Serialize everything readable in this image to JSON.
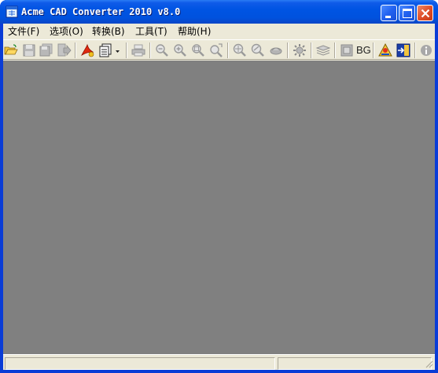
{
  "window": {
    "title": "Acme CAD Converter 2010 v8.0",
    "icon": "app-document-icon"
  },
  "caption_buttons": [
    "minimize-icon",
    "maximize-icon",
    "close-icon"
  ],
  "menu": {
    "items": [
      {
        "label": "文件(F)"
      },
      {
        "label": "选项(O)"
      },
      {
        "label": "转换(B)"
      },
      {
        "label": "工具(T)"
      },
      {
        "label": "帮助(H)"
      }
    ]
  },
  "toolbar": {
    "buttons": [
      {
        "icon": "open-folder-icon",
        "enabled": true
      },
      {
        "icon": "save-icon",
        "enabled": false
      },
      {
        "icon": "save-all-icon",
        "enabled": false
      },
      {
        "icon": "export-icon",
        "enabled": false
      },
      {
        "icon": "pdf-convert-icon",
        "enabled": true
      },
      {
        "icon": "batch-convert-dropdown-icon",
        "enabled": true
      },
      {
        "icon": "print-icon",
        "enabled": false
      },
      {
        "icon": "zoom-out-icon",
        "enabled": false
      },
      {
        "icon": "zoom-in-icon",
        "enabled": false
      },
      {
        "icon": "zoom-fit-icon",
        "enabled": false
      },
      {
        "icon": "zoom-extents-icon",
        "enabled": false
      },
      {
        "icon": "zoom-window-icon",
        "enabled": false
      },
      {
        "icon": "zoom-realtime-icon",
        "enabled": false
      },
      {
        "icon": "pan-icon",
        "enabled": false
      },
      {
        "icon": "settings-icon",
        "enabled": false
      },
      {
        "icon": "layers-icon",
        "enabled": false
      },
      {
        "icon": "black-white-icon",
        "enabled": false
      },
      {
        "icon": "about-icon",
        "enabled": true
      },
      {
        "icon": "exit-icon",
        "enabled": true
      },
      {
        "icon": "info-icon",
        "enabled": true
      }
    ],
    "bg_label": "BG"
  },
  "colors": {
    "titlebar": "#0054e3",
    "workspace": "#808080",
    "chrome": "#ece9d8",
    "close_button": "#e0502a"
  }
}
